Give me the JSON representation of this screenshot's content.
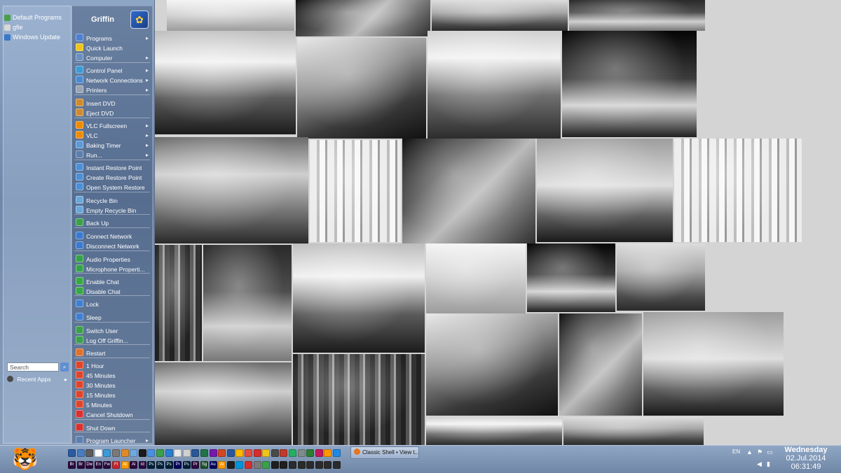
{
  "start_menu": {
    "user_name": "Griffin",
    "pinned": [
      {
        "label": "Default Programs",
        "icon": "default-programs-icon",
        "color": "#4aa04a"
      },
      {
        "label": "gfie",
        "icon": "gfie-icon",
        "color": "#d9d9d9"
      },
      {
        "label": "Windows Update",
        "icon": "windows-update-icon",
        "color": "#3a78c9"
      }
    ],
    "items": [
      {
        "label": "Programs",
        "icon": "programs-icon",
        "color": "#4f7fd0",
        "submenu": true
      },
      {
        "label": "Quick Launch",
        "icon": "quick-launch-icon",
        "color": "#f0c419",
        "submenu": false
      },
      {
        "label": "Computer",
        "icon": "computer-icon",
        "color": "#6b8fbf",
        "submenu": true
      },
      {
        "label": "Control Panel",
        "icon": "control-panel-icon",
        "color": "#3c9ad4",
        "submenu": true
      },
      {
        "label": "Network Connections",
        "icon": "network-connections-icon",
        "color": "#4a8ad0",
        "submenu": true
      },
      {
        "label": "Printers",
        "icon": "printers-icon",
        "color": "#9aa4b3",
        "submenu": true
      },
      {
        "label": "Insert DVD",
        "icon": "insert-dvd-icon",
        "color": "#d08a2e",
        "submenu": false
      },
      {
        "label": "Eject DVD",
        "icon": "eject-dvd-icon",
        "color": "#d08a2e",
        "submenu": false
      },
      {
        "label": "VLC Fullscreen",
        "icon": "vlc-icon",
        "color": "#f08a00",
        "submenu": true
      },
      {
        "label": "VLC",
        "icon": "vlc-icon",
        "color": "#f08a00",
        "submenu": true
      },
      {
        "label": "Baking Timer",
        "icon": "baking-timer-icon",
        "color": "#5c9ad8",
        "submenu": true
      },
      {
        "label": "Run...",
        "icon": "run-icon",
        "color": "#5c7fb0",
        "submenu": true
      },
      {
        "label": "Instant Restore Point",
        "icon": "restore-point-icon",
        "color": "#4b8fd6",
        "submenu": false
      },
      {
        "label": "Create Restore Point",
        "icon": "restore-point-icon",
        "color": "#4b8fd6",
        "submenu": false
      },
      {
        "label": "Open System Restore",
        "icon": "system-restore-icon",
        "color": "#4b8fd6",
        "submenu": false
      },
      {
        "label": "Recycle Bin",
        "icon": "recycle-bin-icon",
        "color": "#6aa6d9",
        "submenu": false
      },
      {
        "label": "Empty Recycle Bin",
        "icon": "empty-recycle-bin-icon",
        "color": "#6aa6d9",
        "submenu": false
      },
      {
        "label": "Back Up",
        "icon": "back-up-icon",
        "color": "#3aa04a",
        "submenu": false
      },
      {
        "label": "Connect Network",
        "icon": "connect-network-icon",
        "color": "#3a7ad0",
        "submenu": false
      },
      {
        "label": "Disconnect Network",
        "icon": "disconnect-network-icon",
        "color": "#3a7ad0",
        "submenu": false
      },
      {
        "label": "Audio Properties",
        "icon": "audio-icon",
        "color": "#36a34a",
        "submenu": false
      },
      {
        "label": "Microphone Properti...",
        "icon": "microphone-icon",
        "color": "#36a34a",
        "submenu": false
      },
      {
        "label": "Enable Chat",
        "icon": "chat-icon",
        "color": "#38a845",
        "submenu": false
      },
      {
        "label": "Disable Chat",
        "icon": "chat-icon",
        "color": "#38a845",
        "submenu": false
      },
      {
        "label": "Lock",
        "icon": "lock-icon",
        "color": "#3f7fd1",
        "submenu": false
      },
      {
        "label": "Sleep",
        "icon": "sleep-icon",
        "color": "#3f7fd1",
        "submenu": false
      },
      {
        "label": "Switch User",
        "icon": "switch-user-icon",
        "color": "#3aa04a",
        "submenu": false
      },
      {
        "label": "Log Off Griffin...",
        "icon": "log-off-icon",
        "color": "#3aa04a",
        "submenu": false
      },
      {
        "label": "Restart",
        "icon": "restart-icon",
        "color": "#e0702a",
        "submenu": false
      },
      {
        "label": "1 Hour",
        "icon": "timer-icon",
        "color": "#e0442a",
        "submenu": false
      },
      {
        "label": "45 Minutes",
        "icon": "timer-icon",
        "color": "#e0442a",
        "submenu": false
      },
      {
        "label": "30 Minutes",
        "icon": "timer-icon",
        "color": "#e0442a",
        "submenu": false
      },
      {
        "label": "15 Minutes",
        "icon": "timer-icon",
        "color": "#e0442a",
        "submenu": false
      },
      {
        "label": "5 Minutes",
        "icon": "timer-icon",
        "color": "#e0442a",
        "submenu": false
      },
      {
        "label": "Cancel Shutdown",
        "icon": "cancel-icon",
        "color": "#d93030",
        "submenu": false
      },
      {
        "label": "Shut Down",
        "icon": "shut-down-icon",
        "color": "#d93030",
        "submenu": false
      },
      {
        "label": "Program Launcher",
        "icon": "program-launcher-icon",
        "color": "#5c7fb0",
        "submenu": true
      }
    ],
    "search_placeholder": "Search",
    "recent_apps_label": "Recent Apps"
  },
  "taskbar": {
    "quick_launch_top": [
      "#2c5aa0",
      "#4a7dc0",
      "#5d5d5d",
      "#ffffff",
      "#3a9bd8",
      "#7a7a7a",
      "#e08b2a",
      "#6fa8dc",
      "#1a1a1a",
      "#4a90e2",
      "#3aa04a",
      "#2a7fd0",
      "#e8e8e8",
      "#d0d0d0",
      "#2b5797",
      "#217346",
      "#7719aa",
      "#d24726",
      "#2b579a",
      "#ffb900",
      "#e74c3c",
      "#d32f2f",
      "#f0c419",
      "#4a4a4a",
      "#c0392b",
      "#27ae60",
      "#7f8c8d",
      "#2e7d32",
      "#c2185b",
      "#ff9800",
      "#1e88e5"
    ],
    "quick_launch_bottom": [
      "#2b0a3d",
      "#2b0a3d",
      "#2b0a3d",
      "#2b0a3d",
      "#2b0a3d",
      "#c1272d",
      "#ff9a00",
      "#2b0a3d",
      "#2b0a3d",
      "#001e36",
      "#001e36",
      "#001e36",
      "#00005b",
      "#001e36",
      "#2b0a3d",
      "#1e4d2b",
      "#00005b",
      "#ff9a00",
      "#1f1f1f",
      "#0095da",
      "#d32f2f",
      "#7a7a7a",
      "#3aa04a",
      "#1f1f1f",
      "#1f1f1f",
      "#2b2b2b",
      "#2b2b2b",
      "#2b2b2b",
      "#2b2b2b",
      "#2b2b2b",
      "#2b2b2b"
    ],
    "quick_launch_bottom_labels": [
      "Br",
      "Br",
      "Dw",
      "En",
      "Fw",
      "Fl",
      "Ai",
      "Ai",
      "Id",
      "Ps",
      "Ps",
      "Ps",
      "Pr",
      "Ps",
      "Pr",
      "Sg",
      "Au",
      "Ai",
      "",
      "",
      "",
      "",
      "",
      "",
      "",
      "",
      "",
      "",
      "",
      "",
      ""
    ],
    "window_button_label": "Classic Shell • View t...",
    "language": "EN",
    "clock": {
      "day": "Wednesday",
      "date": "02.Jul.2014",
      "time": "06:31:49"
    }
  }
}
